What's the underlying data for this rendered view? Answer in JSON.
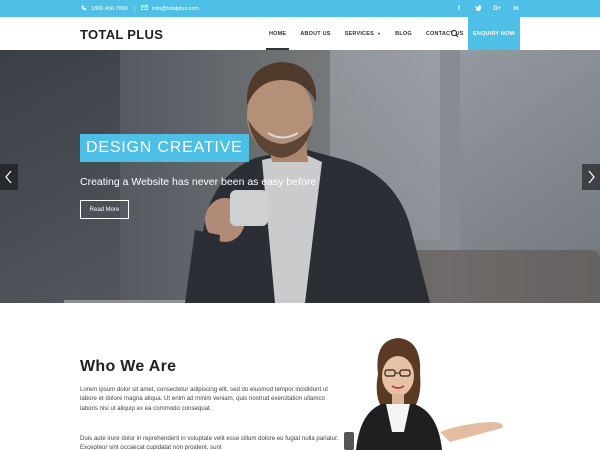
{
  "topbar": {
    "phone": "1800 456 7890",
    "separator": "|",
    "email": "info@totalplus.com",
    "social": [
      "f",
      "t",
      "G+",
      "in"
    ],
    "icons": [
      "phone-icon",
      "envelope-icon"
    ],
    "color": "#4ec0e8"
  },
  "header": {
    "logo": "TOTAL PLUS",
    "nav": [
      {
        "label": "HOME",
        "active": true
      },
      {
        "label": "ABOUT US"
      },
      {
        "label": "SERVICES",
        "dropdown": true
      },
      {
        "label": "BLOG"
      },
      {
        "label": "CONTACT US"
      }
    ],
    "search_icon": "search-icon",
    "enquiry": "ENQUIRY NOW"
  },
  "hero": {
    "tag": "DESIGN CREATIVE",
    "subtitle": "Creating a Website has never been as easy before",
    "button": "Read More",
    "prev_icon": "chevron-left-icon",
    "next_icon": "chevron-right-icon"
  },
  "who": {
    "title": "Who We Are",
    "paragraph1": "Lorem ipsum dolor sit amet, consectetur adipiscing elit, sed do eiusmod tempor incididunt ut labore et dolore magna aliqua. Ut enim ad minim veniam, quis nostrud exercitation ullamco laboris nisi ut aliquip ex ea commodo consequat.",
    "paragraph2": "Duis aute irure dolor in reprehenderit in voluptate velit esse cillum dolore eu fugiat nulla pariatur. Excepteur sint occaecat cupidatat non proident, sunt"
  }
}
